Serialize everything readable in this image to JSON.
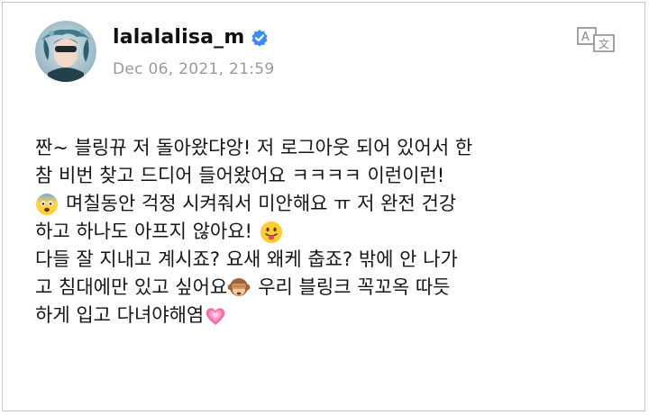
{
  "post": {
    "username": "lalalalisa_m",
    "timestamp": "Dec 06, 2021, 21:59",
    "lines": {
      "l1": "짠~ 블링뀨 저 돌아왔댜앙! 저 로그아웃 되어 있어서 한",
      "l2": "참 비번 찾고 드디어 들어왔어요 ㅋㅋㅋㅋ 이런이런!",
      "l3": "며칠동안 걱정 시켜줘서 미안해요 ㅠ 저 완전 건강",
      "l4": "하고 하나도 아프지 않아요!",
      "l5": "다들 잘 지내고 계시죠? 요새 왜케 춥죠? 밖에 안 나가",
      "l6a": "고 침대에만 있고 싶어요",
      "l6b": "우리 블링크 꼭꼬옥 따듯",
      "l7": "하게 입고 다녀야해염"
    },
    "emojis": {
      "fearful": "fearful-face-emoji",
      "tongue": "face-with-tongue-emoji",
      "monkey": "see-no-evil-monkey-emoji",
      "heart": "growing-heart-emoji"
    }
  },
  "icons": {
    "verified": "verified-badge-icon",
    "translate": "translate-icon"
  },
  "colors": {
    "verified_blue": "#3b8df0",
    "timestamp_gray": "#9a9a9a",
    "text": "#161616",
    "border": "#c8c8c8"
  }
}
